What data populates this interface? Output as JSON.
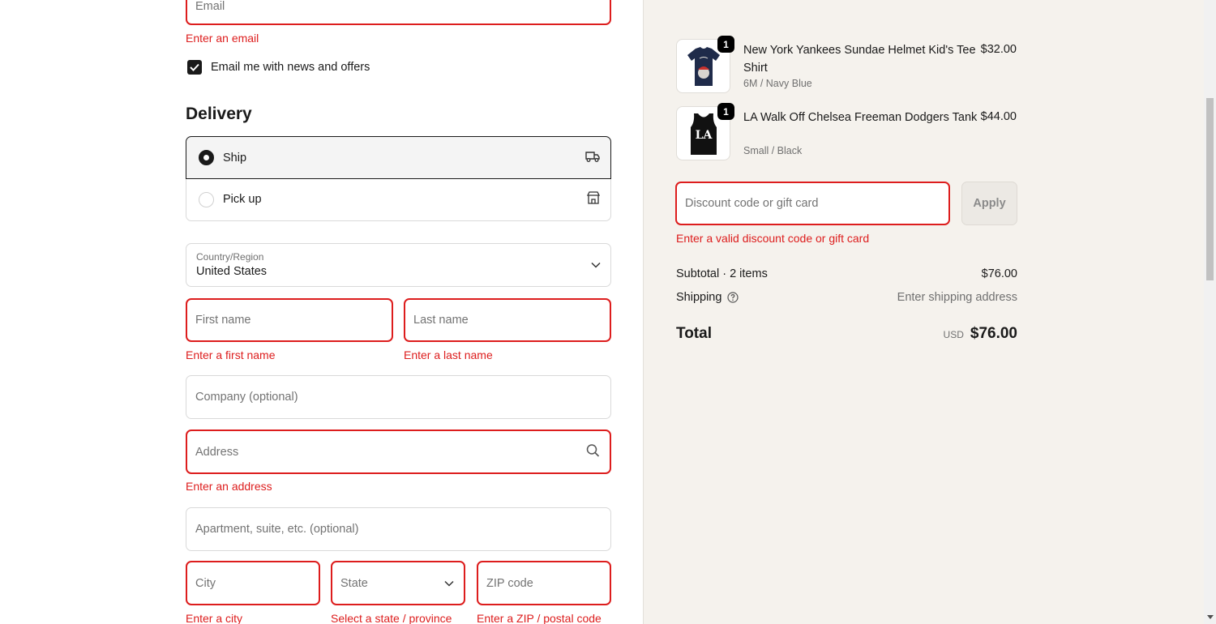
{
  "contact": {
    "email_placeholder": "Email",
    "email_error": "Enter an email",
    "newsletter_label": "Email me with news and offers",
    "newsletter_checked": true
  },
  "delivery": {
    "title": "Delivery",
    "options": [
      {
        "label": "Ship",
        "selected": true,
        "icon": "truck-icon"
      },
      {
        "label": "Pick up",
        "selected": false,
        "icon": "store-icon"
      }
    ],
    "country_label": "Country/Region",
    "country_value": "United States",
    "first_name_placeholder": "First name",
    "first_name_error": "Enter a first name",
    "last_name_placeholder": "Last name",
    "last_name_error": "Enter a last name",
    "company_placeholder": "Company (optional)",
    "address_placeholder": "Address",
    "address_error": "Enter an address",
    "apartment_placeholder": "Apartment, suite, etc. (optional)",
    "city_placeholder": "City",
    "city_error": "Enter a city",
    "state_placeholder": "State",
    "state_error": "Select a state / province",
    "zip_placeholder": "ZIP code",
    "zip_error": "Enter a ZIP / postal code"
  },
  "cart": {
    "items": [
      {
        "title": "New York Yankees Sundae Helmet Kid's Tee Shirt",
        "variant": "6M / Navy Blue",
        "price": "$32.00",
        "quantity": "1"
      },
      {
        "title": "LA Walk Off Chelsea Freeman Dodgers Tank",
        "variant": "Small / Black",
        "price": "$44.00",
        "quantity": "1"
      }
    ],
    "discount_placeholder": "Discount code or gift card",
    "discount_error": "Enter a valid discount code or gift card",
    "apply_label": "Apply",
    "subtotal_label": "Subtotal · 2 items",
    "subtotal_value": "$76.00",
    "shipping_label": "Shipping",
    "shipping_value": "Enter shipping address",
    "total_label": "Total",
    "currency": "USD",
    "total_value": "$76.00"
  },
  "colors": {
    "error": "#dd1d1d",
    "sidebar_bg": "#f5f2ed",
    "dark": "#1a1a1a"
  }
}
